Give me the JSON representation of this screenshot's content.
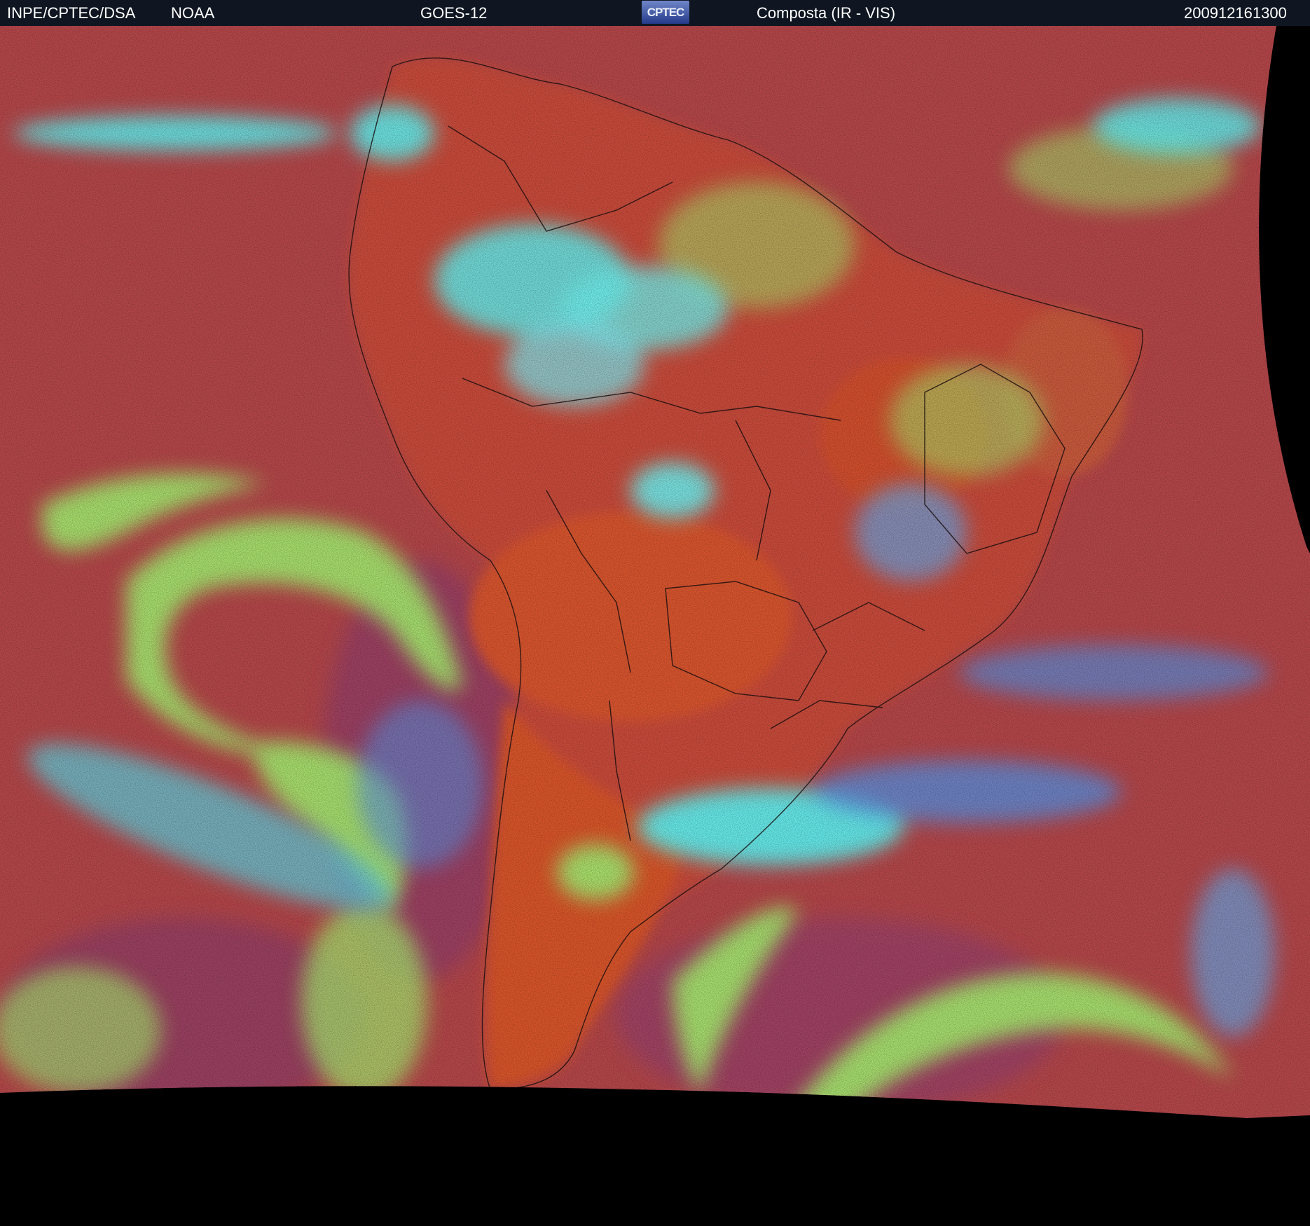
{
  "header": {
    "agency": "INPE/CPTEC/DSA",
    "provider": "NOAA",
    "satellite": "GOES-12",
    "logo_text": "CPTEC",
    "product": "Composta (IR - VIS)",
    "timestamp": "200912161300"
  },
  "colors": {
    "header_bg": "#0f1621",
    "ocean_red": "#b5474a",
    "land_orange": "#d9542d",
    "cloud_green": "#a6e66e",
    "cloud_cyan": "#5ff0f0",
    "cloud_blue": "#5a8ede",
    "space": "#000000",
    "border_line": "#1a0f10"
  }
}
